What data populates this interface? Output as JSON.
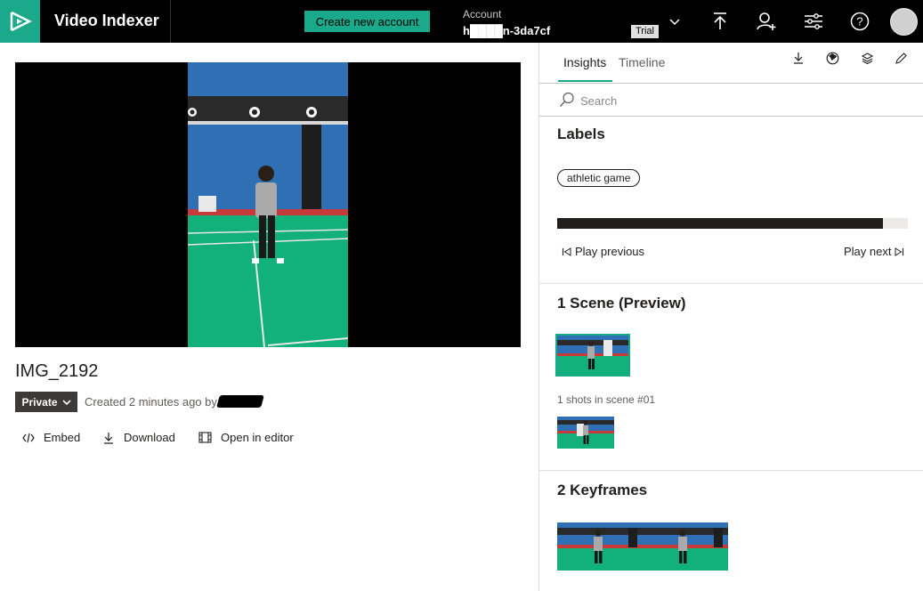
{
  "topbar": {
    "app_title": "Video Indexer",
    "create_account_label": "Create new account",
    "account_label": "Account",
    "account_name": "h████n-3da7cf",
    "trial_badge": "Trial",
    "accent_color": "#1aa98a"
  },
  "video": {
    "title": "IMG_2192",
    "privacy": "Private",
    "created_text": "Created 2 minutes ago by"
  },
  "actions": {
    "embed": "Embed",
    "download": "Download",
    "open_in_editor": "Open in editor"
  },
  "insights_pane": {
    "tabs": [
      "Insights",
      "Timeline"
    ],
    "active_tab": "Insights",
    "toolbar_icons": [
      "download-icon",
      "globe-icon",
      "layers-icon",
      "edit-icon"
    ],
    "search_placeholder": "Search",
    "labels": {
      "title": "Labels",
      "items": [
        "athletic game"
      ],
      "appearance_fraction": 0.93,
      "play_previous": "Play previous",
      "play_next": "Play next"
    },
    "scenes": {
      "title": "1 Scene (Preview)",
      "shots_caption": "1 shots in scene #01"
    },
    "keyframes": {
      "title": "2 Keyframes"
    }
  }
}
